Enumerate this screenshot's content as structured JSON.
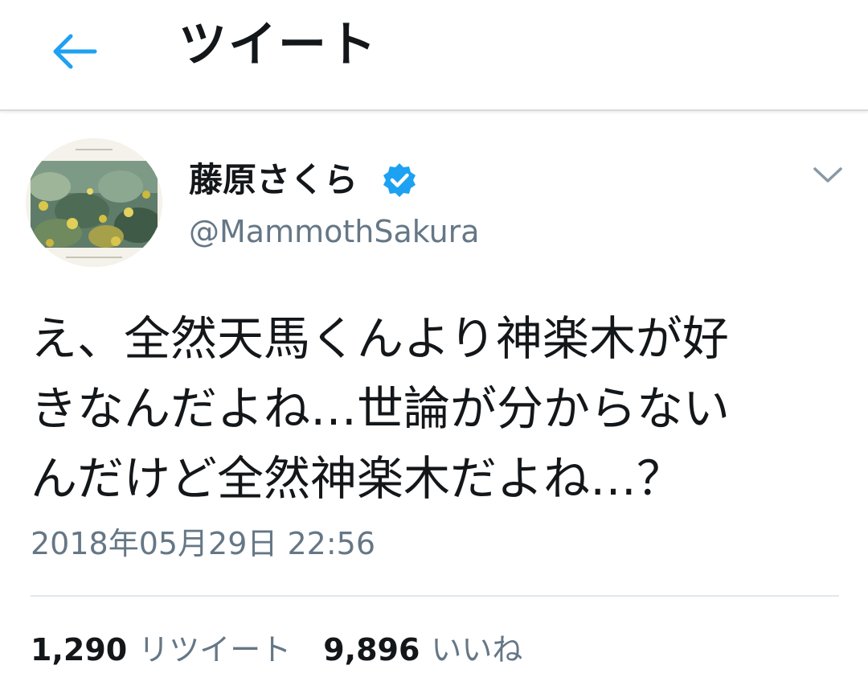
{
  "header": {
    "title": "ツイート",
    "back_icon": "arrow-left-icon",
    "accent_color": "#1da1f2"
  },
  "tweet": {
    "author": {
      "display_name": "藤原さくら",
      "handle": "@MammothSakura",
      "verified": true,
      "verified_icon": "verified-badge-icon"
    },
    "menu_icon": "chevron-down-icon",
    "text": "え、全然天馬くんより神楽木が好\nきなんだよね…世論が分からない\nんだけど全然神楽木だよね…？",
    "timestamp": "2018年05月29日 22:56",
    "stats": {
      "retweets": {
        "count": "1,290",
        "label": "リツイート"
      },
      "likes": {
        "count": "9,896",
        "label": "いいね"
      }
    }
  }
}
